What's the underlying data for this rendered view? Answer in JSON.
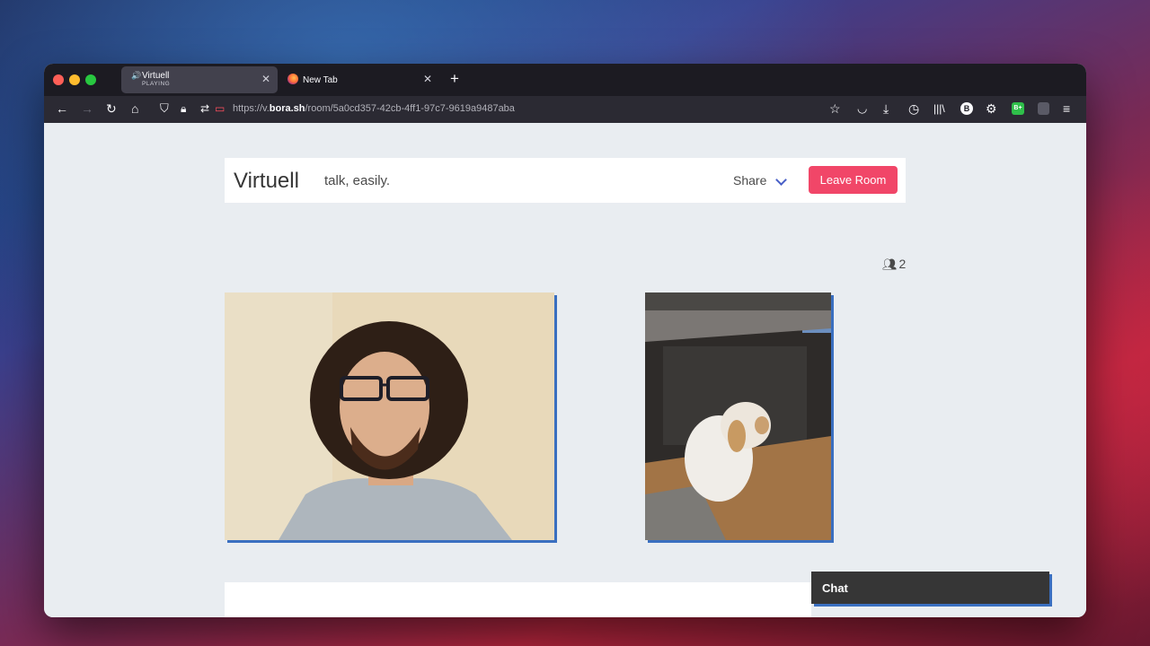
{
  "browser": {
    "tabs": [
      {
        "title": "Virtuell",
        "subtitle": "PLAYING",
        "audio_icon": "speaker-icon",
        "active": true
      },
      {
        "title": "New Tab",
        "favicon": "firefox-icon",
        "active": false
      }
    ],
    "url": {
      "scheme": "https://v.",
      "domain": "bora.sh",
      "path": "/room/5a0cd357-42cb-4ff1-97c7-9619a9487aba"
    },
    "extension_badge_b": "B",
    "extension_badge_green": "B+"
  },
  "app": {
    "brand": "Virtuell",
    "tagline": "talk, easily.",
    "share_label": "Share",
    "leave_label": "Leave Room",
    "participant_count": "2",
    "chat_title": "Chat"
  },
  "colors": {
    "leave_button": "#f14668",
    "share_chevron": "#485fc7",
    "video_shadow": "#3a6fc0",
    "chat_header": "#363636"
  }
}
